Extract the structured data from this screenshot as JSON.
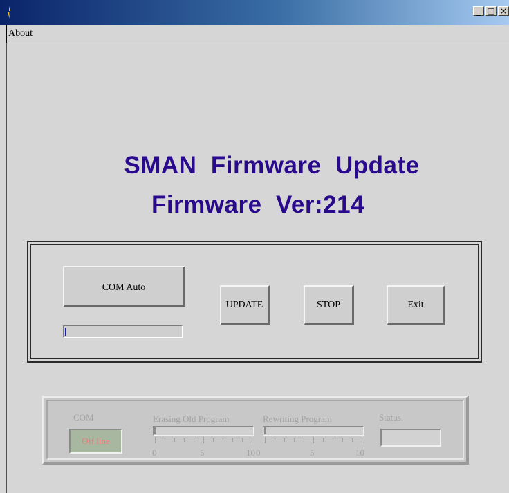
{
  "window": {
    "title": "",
    "buttons": [
      {
        "name": "minimize",
        "glyph": "_"
      },
      {
        "name": "maximize",
        "glyph": "□"
      },
      {
        "name": "close",
        "glyph": "×"
      }
    ]
  },
  "menu": {
    "items": [
      "About"
    ]
  },
  "heading": {
    "line1": "SMAN  Firmware  Update",
    "line2": "Firmware  Ver:214"
  },
  "controls": {
    "com_button": "COM Auto",
    "update_button": "UPDATE",
    "stop_button": "STOP",
    "exit_button": "Exit",
    "com_progress": 0
  },
  "status_panel": {
    "com_label": "COM",
    "com_state": "Off line",
    "erasing_label": "Erasing Old Program",
    "erasing_value": 0,
    "erasing_ticks": [
      "0",
      "5",
      "10"
    ],
    "rewriting_label": "Rewriting Program",
    "rewriting_value": 0,
    "rewriting_ticks": [
      "0",
      "5",
      "10"
    ],
    "status_label": "Status.",
    "status_value": ""
  },
  "colors": {
    "heading": "#2a0a8c",
    "titlebar": "#0a246a",
    "offline": "#f07a7a"
  }
}
